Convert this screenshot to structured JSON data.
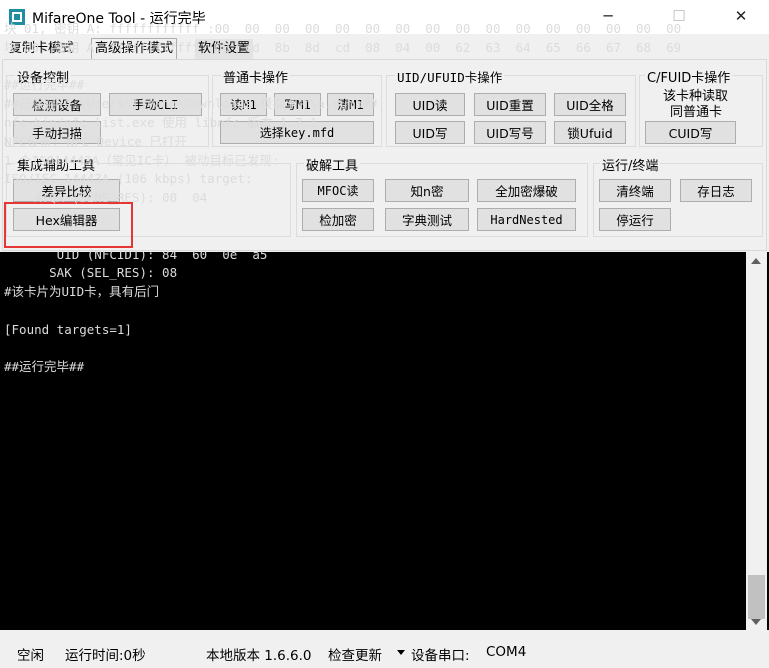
{
  "window": {
    "title": "MifareOne Tool - 运行完毕",
    "minimize": "─",
    "maximize": "☐",
    "close": "✕"
  },
  "tabs": [
    "复制卡模式",
    "高级操作模式",
    "软件设置"
  ],
  "groups": {
    "device": {
      "label": "设备控制",
      "buttons": [
        "检测设备",
        "手动CLI",
        "手动扫描"
      ]
    },
    "normal": {
      "label": "普通卡操作",
      "buttons": [
        "读M1",
        "写M1",
        "清M1",
        "选择key.mfd"
      ]
    },
    "uid": {
      "label": "UID/UFUID卡操作",
      "buttons": [
        "UID读",
        "UID重置",
        "UID全格",
        "UID写",
        "UID写号",
        "锁Ufuid"
      ]
    },
    "cfuid": {
      "label": "C/FUID卡操作",
      "note1": "该卡种读取",
      "note2": "同普通卡",
      "button": "CUID写"
    },
    "aux": {
      "label": "集成辅助工具",
      "buttons": [
        "差异比较",
        "Hex编辑器"
      ]
    },
    "crack": {
      "label": "破解工具",
      "buttons": [
        "MFOC读",
        "知n密",
        "全加密爆破",
        "检加密",
        "字典测试",
        "HardNested"
      ]
    },
    "run": {
      "label": "运行/终端",
      "buttons": [
        "清终端",
        "存日志",
        "停运行"
      ]
    }
  },
  "console": {
    "lines": [
      "块 01, 密钥 A: ffffffffffff :00  00  00  00  00  00  00  00  00  00  00  00  00  00  00  00",
      "块 00, 密钥 A: ffffffffffff :06  cd  8b  8d  cd  08  04  00  62  63  64  65  66  67  68  69",
      "",
      "##运行完毕##",
      "##已保存-C:\\Users\\liyang\\Downloads\\模拟卡片\\a.dump##",
      "nfc-bin/nfc-list.exe 使用 libnfc 版本 1.7.1",
      "NFC设备: NFC-Device 已打开",
      "1 个ISO14443A（常见IC卡） 被动目标已发现:",
      "ISO/IEC 14443A (106 kbps) target:",
      "    ATQA (SENS_RES): 00  04",
      "",
      "",
      "       UID (NFCID1): 84  60  0e  a5",
      "      SAK (SEL_RES): 08",
      "#该卡片为UID卡，具有后门",
      "",
      "[Found targets=1]",
      "",
      "##运行完毕##"
    ]
  },
  "status": {
    "state": "空闲",
    "runtime": "运行时间:0秒",
    "version": "本地版本 1.6.6.0",
    "update": "检查更新",
    "port_label": "设备串口:",
    "port": "COM4"
  }
}
